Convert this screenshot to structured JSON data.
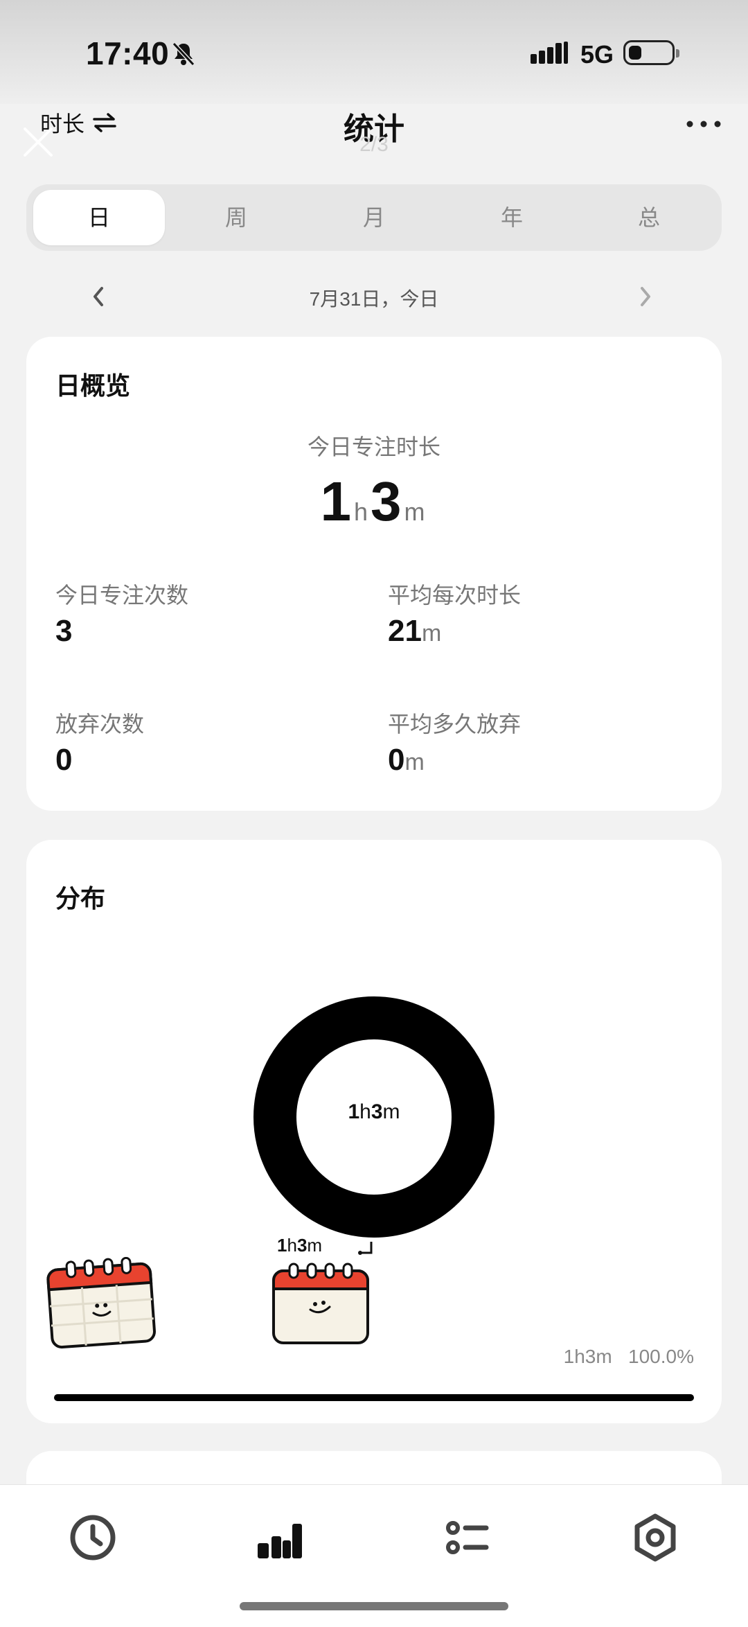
{
  "status_bar": {
    "time": "17:40",
    "network": "5G",
    "icons": [
      "bell-off-icon",
      "signal-icon",
      "battery-icon"
    ]
  },
  "header": {
    "mode_label": "时长",
    "title": "统计",
    "page_indicator": "2/3",
    "icons": [
      "swap-icon",
      "close-icon",
      "more-icon"
    ]
  },
  "period_tabs": [
    {
      "label": "日",
      "active": true
    },
    {
      "label": "周",
      "active": false
    },
    {
      "label": "月",
      "active": false
    },
    {
      "label": "年",
      "active": false
    },
    {
      "label": "总",
      "active": false
    }
  ],
  "date_nav": {
    "label": "7月31日，今日",
    "icons": [
      "chevron-left-icon",
      "chevron-right-icon"
    ]
  },
  "overview": {
    "title": "日概览",
    "focus_label": "今日专注时长",
    "focus_hours": "1",
    "focus_hours_unit": "h",
    "focus_minutes": "3",
    "focus_minutes_unit": "m",
    "stats": [
      {
        "label": "今日专注次数",
        "value": "3",
        "unit": ""
      },
      {
        "label": "平均每次时长",
        "value": "21",
        "unit": "m"
      },
      {
        "label": "放弃次数",
        "value": "0",
        "unit": ""
      },
      {
        "label": "平均多久放弃",
        "value": "0",
        "unit": "m"
      }
    ]
  },
  "distribution": {
    "title": "分布",
    "center_hours": "1",
    "center_h": "h",
    "center_minutes": "3",
    "center_m": "m",
    "tag_hours": "1",
    "tag_h": "h",
    "tag_minutes": "3",
    "tag_m": "m",
    "legend_duration": "1h3m",
    "legend_percent": "100.0%",
    "share_fraction": 1.0,
    "colors": {
      "ring": "#000000",
      "calendar_top": "#e8432f",
      "calendar_body": "#f6f2e6"
    },
    "icons": [
      "calendar-icon",
      "return-icon"
    ]
  },
  "tab_bar": {
    "icons": [
      "clock-icon",
      "stats-icon",
      "list-icon",
      "settings-icon"
    ],
    "active": "stats-icon"
  }
}
